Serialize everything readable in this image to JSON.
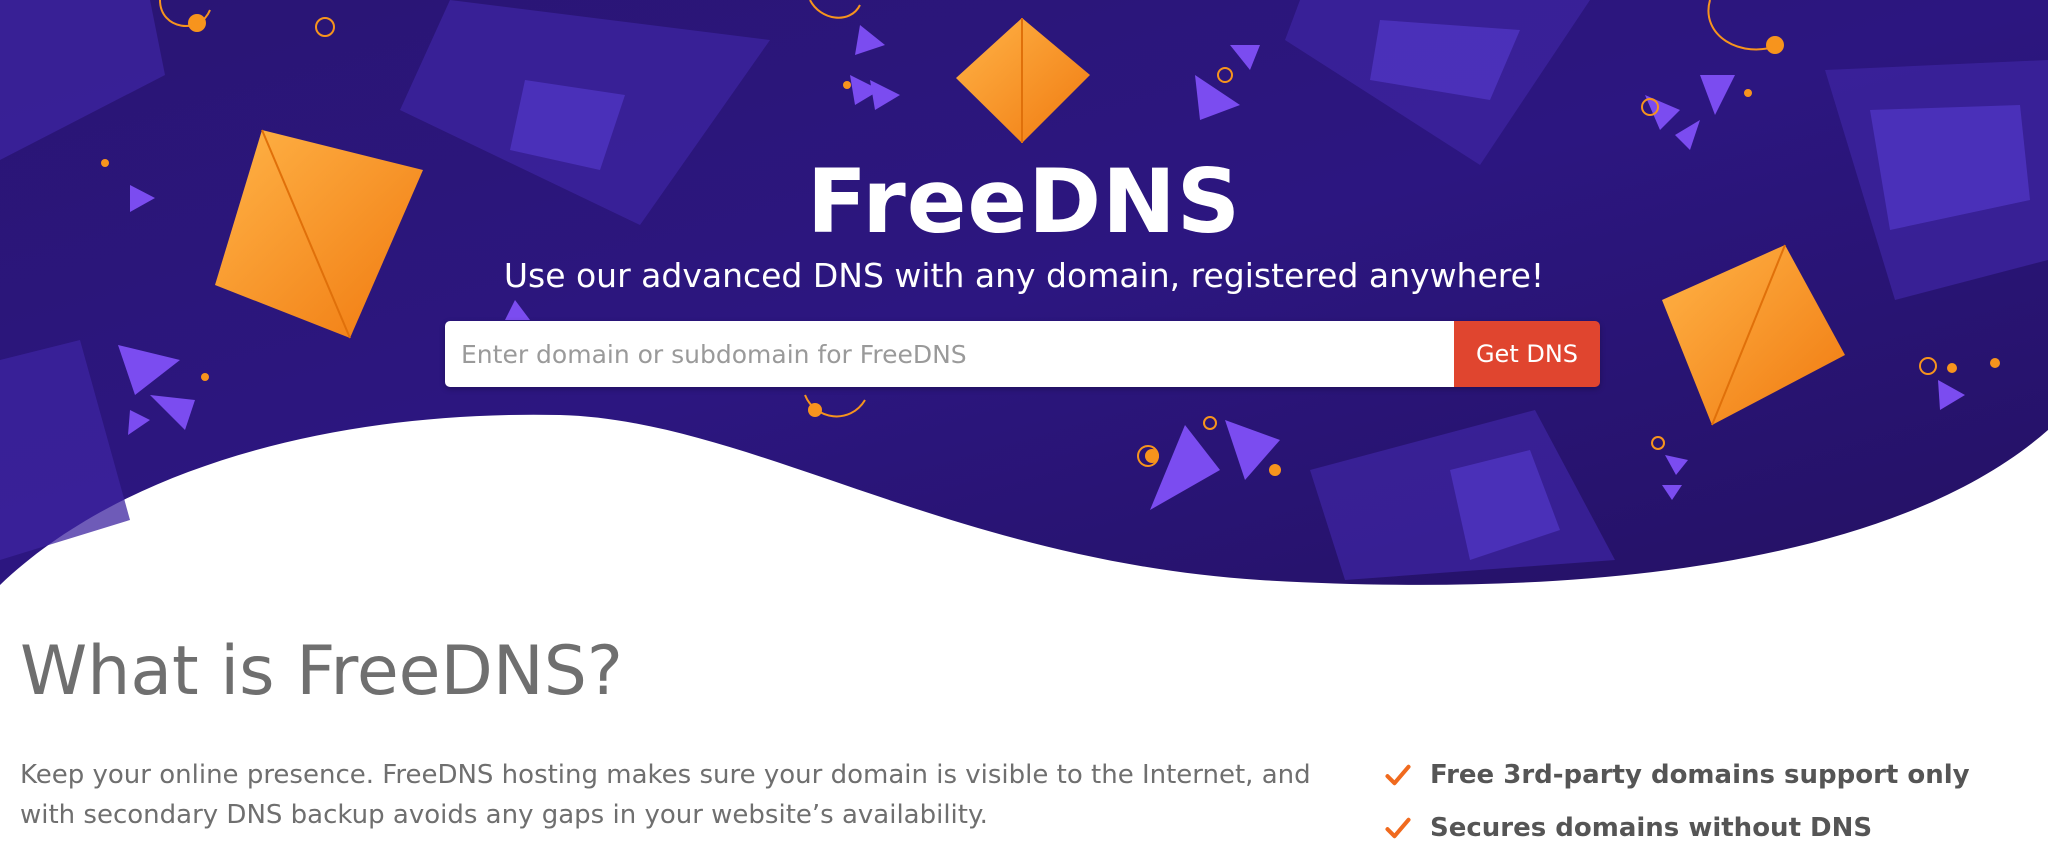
{
  "hero": {
    "title": "FreeDNS",
    "subtitle": "Use our advanced DNS with any domain, registered anywhere!",
    "search": {
      "placeholder": "Enter domain or subdomain for FreeDNS",
      "value": "",
      "button_label": "Get DNS"
    }
  },
  "about": {
    "heading": "What is FreeDNS?",
    "text": "Keep your online presence. FreeDNS hosting makes sure your domain is visible to the Internet, and with secondary DNS backup avoids any gaps in your website’s availability.",
    "features": [
      {
        "icon": "checkmark-icon",
        "label": "Free 3rd-party domains support only"
      },
      {
        "icon": "checkmark-icon",
        "label": "Secures domains without DNS"
      }
    ]
  },
  "colors": {
    "hero_background": "#2a1574",
    "accent_orange": "#f7941d",
    "button_red": "#e0452f",
    "decor_purple": "#6b3fe0",
    "text_gray": "#6f6f6f"
  }
}
